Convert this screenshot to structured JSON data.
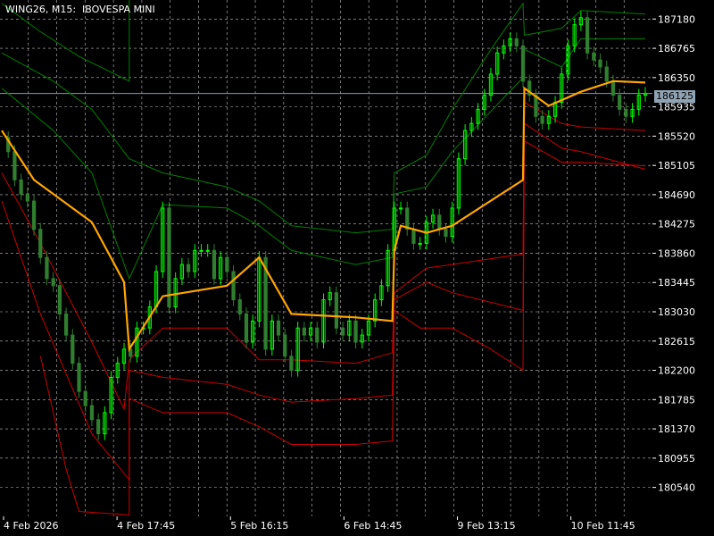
{
  "title": "WING26, M15:  IBOVESPA MINI",
  "current_price": "186125",
  "colors": {
    "background": "#000000",
    "grid": "#c0c0c0",
    "candle_bull": "#00ff00",
    "candle_bear": "#2f7f2f",
    "midline": "#ffa500",
    "upper_bands": "#008000",
    "lower_bands": "#cc0000",
    "current_price_line": "#7f9fb0"
  },
  "chart_data": {
    "type": "line",
    "price_ticks": [
      187180,
      186765,
      186350,
      185935,
      185520,
      185105,
      184690,
      184275,
      183860,
      183445,
      183030,
      182615,
      182200,
      181785,
      181370,
      180955,
      180540
    ],
    "time_labels": [
      "4 Feb 2026",
      "4 Feb 17:45",
      "5 Feb 16:15",
      "6 Feb 14:45",
      "9 Feb 13:15",
      "10 Feb 11:45"
    ],
    "x_range": [
      0,
      100
    ],
    "y_range": [
      180130,
      187450
    ],
    "price_series": [
      [
        0,
        185500
      ],
      [
        1,
        185300
      ],
      [
        2,
        184900
      ],
      [
        3,
        184700
      ],
      [
        4,
        184600
      ],
      [
        5,
        184200
      ],
      [
        6,
        183800
      ],
      [
        7,
        183500
      ],
      [
        8,
        183400
      ],
      [
        9,
        183000
      ],
      [
        10,
        182700
      ],
      [
        11,
        182300
      ],
      [
        12,
        181900
      ],
      [
        13,
        181700
      ],
      [
        14,
        181500
      ],
      [
        15,
        181300
      ],
      [
        16,
        181600
      ],
      [
        17,
        182100
      ],
      [
        18,
        182300
      ],
      [
        19,
        182500
      ],
      [
        20,
        182400
      ],
      [
        21,
        182800
      ],
      [
        22,
        182800
      ],
      [
        23,
        183100
      ],
      [
        24,
        183600
      ],
      [
        25,
        184500
      ],
      [
        26,
        183100
      ],
      [
        27,
        183500
      ],
      [
        28,
        183700
      ],
      [
        29,
        183600
      ],
      [
        30,
        183900
      ],
      [
        31,
        183900
      ],
      [
        32,
        183900
      ],
      [
        33,
        183500
      ],
      [
        34,
        183800
      ],
      [
        35,
        183600
      ],
      [
        36,
        183200
      ],
      [
        37,
        183000
      ],
      [
        38,
        182600
      ],
      [
        39,
        182900
      ],
      [
        40,
        183800
      ],
      [
        41,
        182500
      ],
      [
        42,
        182900
      ],
      [
        43,
        182700
      ],
      [
        44,
        182400
      ],
      [
        45,
        182200
      ],
      [
        46,
        182800
      ],
      [
        47,
        182700
      ],
      [
        48,
        182800
      ],
      [
        49,
        182600
      ],
      [
        50,
        183200
      ],
      [
        51,
        183300
      ],
      [
        52,
        182800
      ],
      [
        53,
        182700
      ],
      [
        54,
        182900
      ],
      [
        55,
        182600
      ],
      [
        56,
        182700
      ],
      [
        57,
        182900
      ],
      [
        58,
        183200
      ],
      [
        59,
        183400
      ],
      [
        60,
        183900
      ],
      [
        61,
        184500
      ],
      [
        62,
        184500
      ],
      [
        63,
        184200
      ],
      [
        64,
        184000
      ],
      [
        65,
        184000
      ],
      [
        66,
        184300
      ],
      [
        67,
        184400
      ],
      [
        68,
        184200
      ],
      [
        69,
        184100
      ],
      [
        70,
        184500
      ],
      [
        71,
        185200
      ],
      [
        72,
        185600
      ],
      [
        73,
        185700
      ],
      [
        74,
        185900
      ],
      [
        75,
        186100
      ],
      [
        76,
        186400
      ],
      [
        77,
        186700
      ],
      [
        78,
        186800
      ],
      [
        79,
        186900
      ],
      [
        80,
        186800
      ],
      [
        81,
        186300
      ],
      [
        82,
        186100
      ],
      [
        83,
        185800
      ],
      [
        84,
        185700
      ],
      [
        85,
        185800
      ],
      [
        86,
        186000
      ],
      [
        87,
        186400
      ],
      [
        88,
        186800
      ],
      [
        89,
        187100
      ],
      [
        90,
        187200
      ],
      [
        91,
        186700
      ],
      [
        92,
        186600
      ],
      [
        93,
        186500
      ],
      [
        94,
        186300
      ],
      [
        95,
        186100
      ],
      [
        96,
        185900
      ],
      [
        97,
        185800
      ],
      [
        98,
        185900
      ],
      [
        99,
        186100
      ],
      [
        100,
        186125
      ]
    ],
    "series": [
      {
        "role": "mid",
        "points": [
          [
            0,
            185600
          ],
          [
            5,
            184900
          ],
          [
            14,
            184300
          ],
          [
            19,
            183450
          ],
          [
            19.8,
            182500
          ],
          [
            25,
            183250
          ],
          [
            35,
            183400
          ],
          [
            40,
            183800
          ],
          [
            45,
            183000
          ],
          [
            55,
            182950
          ],
          [
            60.7,
            182900
          ],
          [
            61,
            183900
          ],
          [
            62,
            184250
          ],
          [
            66,
            184150
          ],
          [
            70,
            184250
          ],
          [
            81,
            184900
          ],
          [
            81.2,
            186200
          ],
          [
            85,
            185950
          ],
          [
            90,
            186150
          ],
          [
            95,
            186300
          ],
          [
            100,
            186280
          ]
        ]
      },
      {
        "role": "upper1",
        "points": [
          [
            0,
            186200
          ],
          [
            8,
            185600
          ],
          [
            14,
            185000
          ],
          [
            19.8,
            183500
          ],
          [
            25,
            184550
          ],
          [
            35,
            184500
          ],
          [
            40,
            184250
          ],
          [
            45,
            183900
          ],
          [
            55,
            183700
          ],
          [
            60.7,
            183800
          ],
          [
            61,
            184700
          ],
          [
            66,
            184800
          ],
          [
            70,
            185300
          ],
          [
            81,
            186350
          ],
          [
            81.2,
            186750
          ],
          [
            87,
            186500
          ],
          [
            90,
            186900
          ],
          [
            100,
            186900
          ]
        ]
      },
      {
        "role": "upper2",
        "points": [
          [
            0,
            186700
          ],
          [
            8,
            186300
          ],
          [
            14,
            185900
          ],
          [
            19.8,
            185200
          ],
          [
            25,
            185000
          ],
          [
            35,
            184800
          ],
          [
            40,
            184600
          ],
          [
            45,
            184250
          ],
          [
            55,
            184150
          ],
          [
            60.7,
            184200
          ],
          [
            61,
            185000
          ],
          [
            66,
            185250
          ],
          [
            70,
            185900
          ],
          [
            76,
            186750
          ],
          [
            81,
            187400
          ],
          [
            81.2,
            186950
          ],
          [
            87,
            187050
          ],
          [
            90,
            187300
          ],
          [
            100,
            187250
          ]
        ]
      },
      {
        "role": "upper3",
        "points": [
          [
            0,
            187400
          ],
          [
            6,
            187000
          ],
          [
            12,
            186650
          ],
          [
            19.8,
            186300
          ],
          [
            19.8,
            187450
          ]
        ]
      },
      {
        "role": "lower1",
        "points": [
          [
            0,
            185000
          ],
          [
            6,
            184000
          ],
          [
            14,
            182600
          ],
          [
            19,
            181650
          ],
          [
            19.8,
            182350
          ],
          [
            25,
            182800
          ],
          [
            35,
            182800
          ],
          [
            40,
            182350
          ],
          [
            45,
            182350
          ],
          [
            55,
            182300
          ],
          [
            60.7,
            182450
          ],
          [
            61,
            183300
          ],
          [
            66,
            183650
          ],
          [
            70,
            183700
          ],
          [
            81,
            183850
          ],
          [
            81.2,
            186000
          ],
          [
            87,
            185700
          ],
          [
            90,
            185650
          ],
          [
            100,
            185600
          ]
        ]
      },
      {
        "role": "lower2",
        "points": [
          [
            0,
            184600
          ],
          [
            6,
            183000
          ],
          [
            14,
            181300
          ],
          [
            19.8,
            180650
          ],
          [
            19.8,
            182200
          ],
          [
            25,
            182100
          ],
          [
            35,
            182000
          ],
          [
            40,
            181850
          ],
          [
            45,
            181750
          ],
          [
            55,
            181800
          ],
          [
            60.7,
            181850
          ],
          [
            61,
            183200
          ],
          [
            66,
            183450
          ],
          [
            70,
            183300
          ],
          [
            81,
            183050
          ],
          [
            81.2,
            185700
          ],
          [
            87,
            185350
          ],
          [
            90,
            185300
          ],
          [
            100,
            185050
          ]
        ]
      },
      {
        "role": "lower3",
        "points": [
          [
            6,
            182400
          ],
          [
            10,
            180800
          ],
          [
            12,
            180200
          ],
          [
            19.8,
            180150
          ],
          [
            19.8,
            181800
          ],
          [
            25,
            181600
          ],
          [
            35,
            181600
          ],
          [
            40,
            181400
          ],
          [
            45,
            181150
          ],
          [
            55,
            181150
          ],
          [
            60.7,
            181200
          ],
          [
            61,
            183050
          ],
          [
            65,
            182800
          ],
          [
            70,
            182800
          ],
          [
            76,
            182500
          ],
          [
            81,
            182200
          ],
          [
            81.2,
            185450
          ],
          [
            87,
            185150
          ],
          [
            90,
            185150
          ],
          [
            100,
            185100
          ]
        ]
      }
    ]
  }
}
